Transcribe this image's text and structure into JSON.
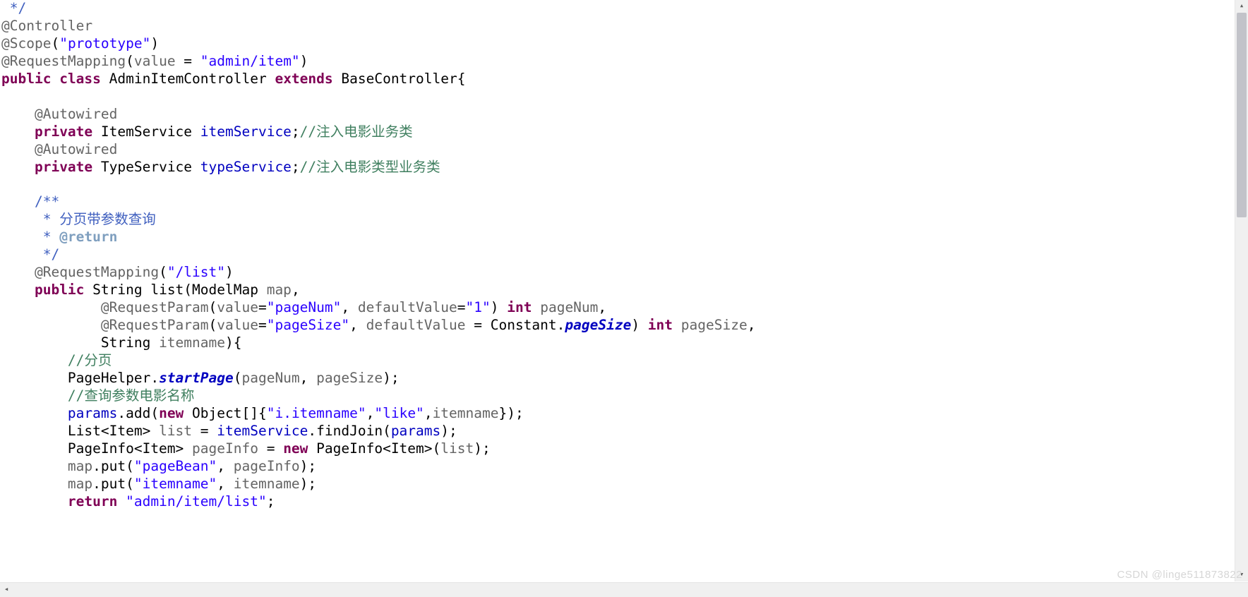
{
  "watermark": "CSDN @linge511873822",
  "code": {
    "l1": {
      "a": " */"
    },
    "l2": {
      "a": "@Controller"
    },
    "l3": {
      "a": "@Scope",
      "b": "(",
      "c": "\"prototype\"",
      "d": ")"
    },
    "l4": {
      "a": "@RequestMapping",
      "b": "(",
      "c": "value",
      "d": " = ",
      "e": "\"admin/item\"",
      "f": ")"
    },
    "l5": {
      "a": "public",
      "b": " ",
      "c": "class",
      "d": " AdminItemController ",
      "e": "extends",
      "f": " BaseController{"
    },
    "l6": {
      "a": ""
    },
    "l7": {
      "a": "    ",
      "b": "@Autowired"
    },
    "l8": {
      "a": "    ",
      "b": "private",
      "c": " ItemService ",
      "d": "itemService",
      "e": ";",
      "f": "//注入电影业务类"
    },
    "l9": {
      "a": "    ",
      "b": "@Autowired"
    },
    "l10": {
      "a": "    ",
      "b": "private",
      "c": " TypeService ",
      "d": "typeService",
      "e": ";",
      "f": "//注入电影类型业务类"
    },
    "l11": {
      "a": ""
    },
    "l12": {
      "a": "    ",
      "b": "/**"
    },
    "l13": {
      "a": "     * ",
      "b": "分页带参数查询"
    },
    "l14": {
      "a": "     * ",
      "b": "@return"
    },
    "l15": {
      "a": "     */"
    },
    "l16": {
      "a": "    ",
      "b": "@RequestMapping",
      "c": "(",
      "d": "\"/list\"",
      "e": ")"
    },
    "l17": {
      "a": "    ",
      "b": "public",
      "c": " String list(ModelMap ",
      "d": "map",
      "e": ","
    },
    "l18": {
      "a": "            ",
      "b": "@RequestParam",
      "c": "(",
      "d": "value",
      "e": "=",
      "f": "\"pageNum\"",
      "g": ", ",
      "h": "defaultValue",
      "i": "=",
      "j": "\"1\"",
      "k": ") ",
      "l": "int",
      "m": " ",
      "n": "pageNum",
      "o": ","
    },
    "l19": {
      "a": "            ",
      "b": "@RequestParam",
      "c": "(",
      "d": "value",
      "e": "=",
      "f": "\"pageSize\"",
      "g": ", ",
      "h": "defaultValue",
      "i": " = Constant.",
      "j": "pageSize",
      "k": ") ",
      "l": "int",
      "m": " ",
      "n": "pageSize",
      "o": ","
    },
    "l20": {
      "a": "            String ",
      "b": "itemname",
      "c": "){"
    },
    "l21": {
      "a": "        ",
      "b": "//分页"
    },
    "l22": {
      "a": "        PageHelper.",
      "b": "startPage",
      "c": "(",
      "d": "pageNum",
      "e": ", ",
      "f": "pageSize",
      "g": ");"
    },
    "l23": {
      "a": "        ",
      "b": "//查询参数电影名称"
    },
    "l24": {
      "a": "        ",
      "b": "params",
      "c": ".add(",
      "d": "new",
      "e": " Object[]{",
      "f": "\"i.itemname\"",
      "g": ",",
      "h": "\"like\"",
      "i": ",",
      "j": "itemname",
      "k": "});"
    },
    "l25": {
      "a": "        List<Item> ",
      "b": "list",
      "c": " = ",
      "d": "itemService",
      "e": ".findJoin(",
      "f": "params",
      "g": ");"
    },
    "l26": {
      "a": "        PageInfo<Item> ",
      "b": "pageInfo",
      "c": " = ",
      "d": "new",
      "e": " PageInfo<Item>(",
      "f": "list",
      "g": ");"
    },
    "l27": {
      "a": "        ",
      "b": "map",
      "c": ".put(",
      "d": "\"pageBean\"",
      "e": ", ",
      "f": "pageInfo",
      "g": ");"
    },
    "l28": {
      "a": "        ",
      "b": "map",
      "c": ".put(",
      "d": "\"itemname\"",
      "e": ", ",
      "f": "itemname",
      "g": ");"
    },
    "l29": {
      "a": "        ",
      "b": "return",
      "c": " ",
      "d": "\"admin/item/list\"",
      "e": ";"
    }
  }
}
